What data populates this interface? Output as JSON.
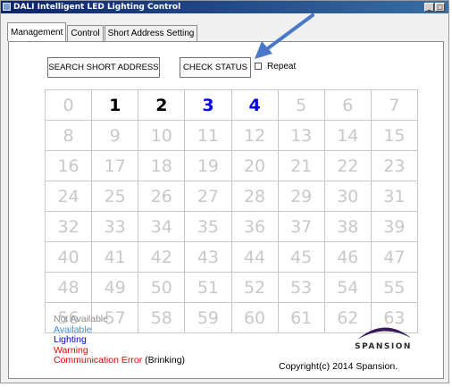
{
  "window": {
    "title": "DALI Intelligent LED Lighting Control",
    "minimize": "_",
    "maximize": "□"
  },
  "tabs": [
    {
      "label": "Management",
      "active": true
    },
    {
      "label": "Control",
      "active": false
    },
    {
      "label": "Short Address Setting",
      "active": false
    }
  ],
  "buttons": {
    "search": "SEARCH SHORT ADDRESS",
    "check": "CHECK STATUS",
    "repeat_label": "Repeat"
  },
  "grid": {
    "cells": [
      {
        "label": "0",
        "status": "not-available"
      },
      {
        "label": "1",
        "status": "lighting-off"
      },
      {
        "label": "2",
        "status": "lighting-off"
      },
      {
        "label": "3",
        "status": "lighting"
      },
      {
        "label": "4",
        "status": "lighting"
      },
      {
        "label": "5",
        "status": "not-available"
      },
      {
        "label": "6",
        "status": "not-available"
      },
      {
        "label": "7",
        "status": "not-available"
      },
      {
        "label": "8",
        "status": "not-available"
      },
      {
        "label": "9",
        "status": "not-available"
      },
      {
        "label": "10",
        "status": "not-available"
      },
      {
        "label": "11",
        "status": "not-available"
      },
      {
        "label": "12",
        "status": "not-available"
      },
      {
        "label": "13",
        "status": "not-available"
      },
      {
        "label": "14",
        "status": "not-available"
      },
      {
        "label": "15",
        "status": "not-available"
      },
      {
        "label": "16",
        "status": "not-available"
      },
      {
        "label": "17",
        "status": "not-available"
      },
      {
        "label": "18",
        "status": "not-available"
      },
      {
        "label": "19",
        "status": "not-available"
      },
      {
        "label": "20",
        "status": "not-available"
      },
      {
        "label": "21",
        "status": "not-available"
      },
      {
        "label": "22",
        "status": "not-available"
      },
      {
        "label": "23",
        "status": "not-available"
      },
      {
        "label": "24",
        "status": "not-available"
      },
      {
        "label": "25",
        "status": "not-available"
      },
      {
        "label": "26",
        "status": "not-available"
      },
      {
        "label": "27",
        "status": "not-available"
      },
      {
        "label": "28",
        "status": "not-available"
      },
      {
        "label": "29",
        "status": "not-available"
      },
      {
        "label": "30",
        "status": "not-available"
      },
      {
        "label": "31",
        "status": "not-available"
      },
      {
        "label": "32",
        "status": "not-available"
      },
      {
        "label": "33",
        "status": "not-available"
      },
      {
        "label": "34",
        "status": "not-available"
      },
      {
        "label": "35",
        "status": "not-available"
      },
      {
        "label": "36",
        "status": "not-available"
      },
      {
        "label": "37",
        "status": "not-available"
      },
      {
        "label": "38",
        "status": "not-available"
      },
      {
        "label": "39",
        "status": "not-available"
      },
      {
        "label": "40",
        "status": "not-available"
      },
      {
        "label": "41",
        "status": "not-available"
      },
      {
        "label": "42",
        "status": "not-available"
      },
      {
        "label": "43",
        "status": "not-available"
      },
      {
        "label": "44",
        "status": "not-available"
      },
      {
        "label": "45",
        "status": "not-available"
      },
      {
        "label": "46",
        "status": "not-available"
      },
      {
        "label": "47",
        "status": "not-available"
      },
      {
        "label": "48",
        "status": "not-available"
      },
      {
        "label": "49",
        "status": "not-available"
      },
      {
        "label": "50",
        "status": "not-available"
      },
      {
        "label": "51",
        "status": "not-available"
      },
      {
        "label": "52",
        "status": "not-available"
      },
      {
        "label": "53",
        "status": "not-available"
      },
      {
        "label": "54",
        "status": "not-available"
      },
      {
        "label": "55",
        "status": "not-available"
      },
      {
        "label": "56",
        "status": "not-available"
      },
      {
        "label": "57",
        "status": "not-available"
      },
      {
        "label": "58",
        "status": "not-available"
      },
      {
        "label": "59",
        "status": "not-available"
      },
      {
        "label": "60",
        "status": "not-available"
      },
      {
        "label": "61",
        "status": "not-available"
      },
      {
        "label": "62",
        "status": "not-available"
      },
      {
        "label": "63",
        "status": "not-available"
      }
    ]
  },
  "status_colors": {
    "not-available": "#c8c8c8",
    "lighting-off": "#000000",
    "lighting": "#0000ee"
  },
  "legend": {
    "not_available": "Not Available",
    "available": "Available",
    "lighting": "Lighting",
    "warning": "Warning",
    "comm_error": "Communication Error",
    "comm_error_suffix": "(Brinking)"
  },
  "legend_colors": {
    "not_available": "#8a8a8a",
    "available": "#3c8fd8",
    "lighting": "#0000ee",
    "warning": "#ee0000",
    "comm_error": "#ee0000"
  },
  "logo": {
    "text": "SPANSION",
    "icon": "spansion-swoosh-icon"
  },
  "copyright": "Copyright(c) 2014 Spansion."
}
